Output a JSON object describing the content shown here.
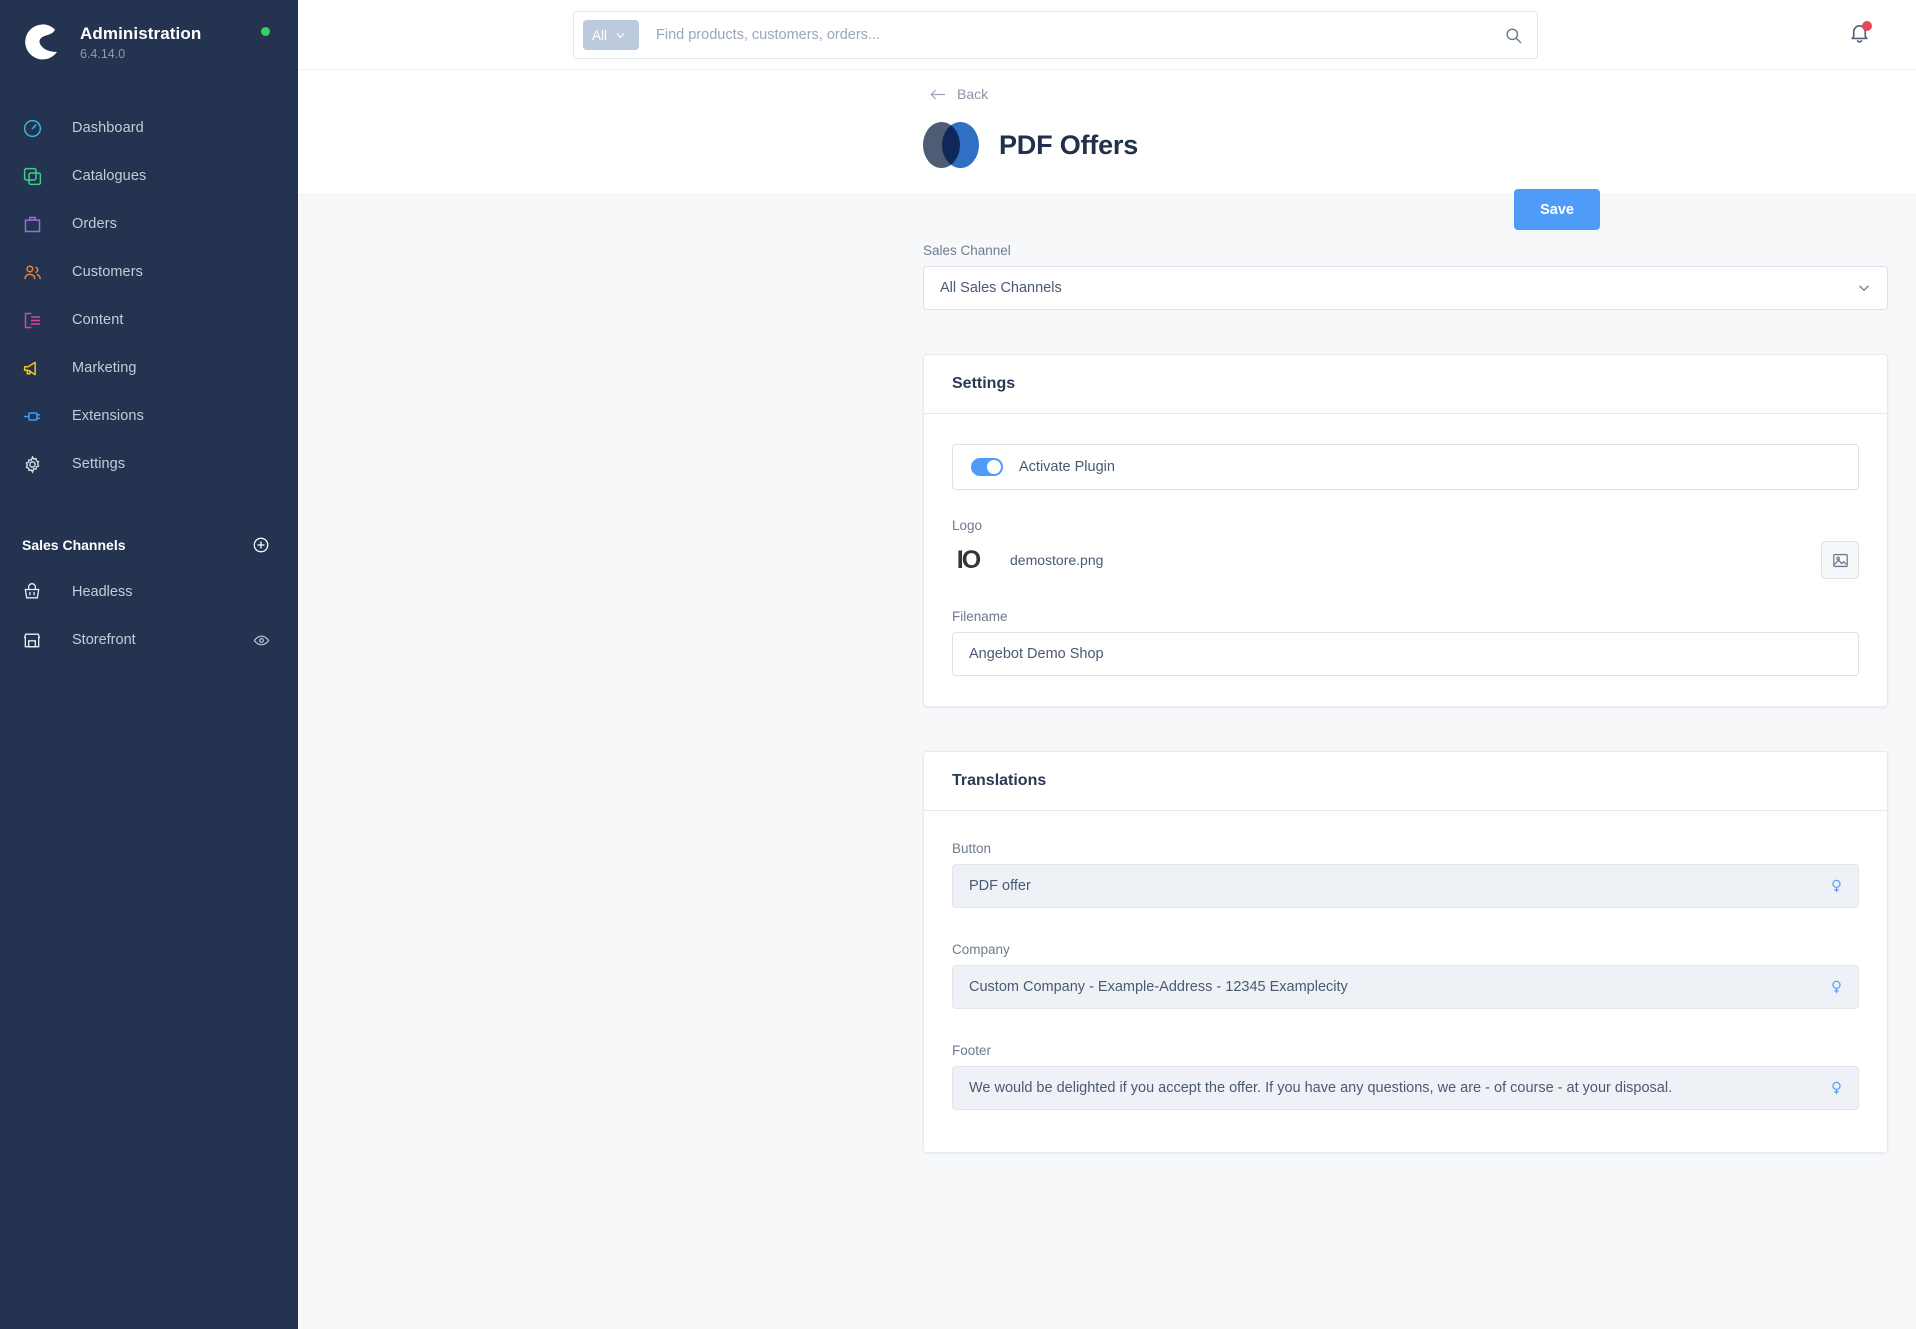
{
  "colors": {
    "sidebar_bg": "#243350",
    "accent_blue": "#4f9cf8",
    "content_bg": "#f7f8fa",
    "status_green": "#37d05c",
    "notification_red": "#e4485d",
    "plugin_icon_slate": "#4e5c74",
    "plugin_icon_blue": "#2f6fc4"
  },
  "sidebar": {
    "brand": {
      "title": "Administration",
      "version": "6.4.14.0",
      "logo_icon": "shopware-logo-icon",
      "status_dot": "online-status-dot"
    },
    "items": [
      {
        "label": "Dashboard",
        "icon": "dashboard-icon",
        "color": "#37b4d6"
      },
      {
        "label": "Catalogues",
        "icon": "catalogues-icon",
        "color": "#3ecf8e"
      },
      {
        "label": "Orders",
        "icon": "orders-icon",
        "color": "#9b6bdf"
      },
      {
        "label": "Customers",
        "icon": "customers-icon",
        "color": "#e8833a"
      },
      {
        "label": "Content",
        "icon": "content-icon",
        "color": "#e0439b"
      },
      {
        "label": "Marketing",
        "icon": "marketing-icon",
        "color": "#f5c518"
      },
      {
        "label": "Extensions",
        "icon": "extensions-icon",
        "color": "#3f9bf5"
      },
      {
        "label": "Settings",
        "icon": "settings-icon",
        "color": "#d8dfe5"
      }
    ],
    "sales_channels": {
      "title": "Sales Channels",
      "add_action": "add-sales-channel-icon",
      "channels": [
        {
          "label": "Headless",
          "icon": "basket-icon"
        },
        {
          "label": "Storefront",
          "icon": "storefront-icon",
          "trailing_icon": "eye-icon"
        }
      ]
    }
  },
  "topbar": {
    "search": {
      "scope_label": "All",
      "scope_chevron": "chevron-down-icon",
      "placeholder": "Find products, customers, orders...",
      "value": "",
      "submit_icon": "search-icon"
    },
    "notifications": {
      "icon": "bell-icon",
      "has_unread": true
    }
  },
  "page": {
    "back_label": "Back",
    "back_icon": "arrow-left-icon",
    "title": "PDF Offers",
    "plugin_icon": "pdf-offers-plugin-icon",
    "save_label": "Save"
  },
  "sales_channel": {
    "label": "Sales Channel",
    "selected": "All Sales Channels",
    "chevron": "chevron-down-icon",
    "options": [
      "All Sales Channels"
    ]
  },
  "settings_card": {
    "title": "Settings",
    "activate": {
      "label": "Activate Plugin",
      "enabled": true
    },
    "logo": {
      "label": "Logo",
      "filename": "demostore.png",
      "thumbnail_text": "IO",
      "upload_icon": "image-picker-icon"
    },
    "filename": {
      "label": "Filename",
      "value": "Angebot Demo Shop",
      "placeholder": ""
    }
  },
  "translations_card": {
    "title": "Translations",
    "fields": [
      {
        "label": "Button",
        "value": "PDF offer",
        "inherit_icon": "inheritance-unlinked-icon"
      },
      {
        "label": "Company",
        "value": "Custom Company - Example-Address - 12345 Examplecity",
        "inherit_icon": "inheritance-unlinked-icon"
      },
      {
        "label": "Footer",
        "value": "We would be delighted if you accept the offer. If you have any questions, we are - of course - at your disposal.",
        "inherit_icon": "inheritance-unlinked-icon"
      }
    ]
  }
}
